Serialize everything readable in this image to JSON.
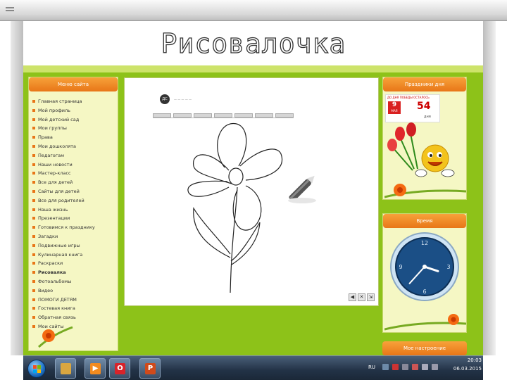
{
  "slide": {
    "title": "Рисовалочка"
  },
  "site": {
    "left_panel": {
      "title": "Меню сайта",
      "items": [
        "Главная страница",
        "Мой профиль",
        "Мой детский сад",
        "Мои группы",
        "Права",
        "Мои дошколята",
        "Педагогам",
        "Наши новости",
        "Мастер-класс",
        "Все для детей",
        "Сайты для детей",
        "Все для родителей",
        "Наша жизнь",
        "Презентации",
        "Готовимся к празднику",
        "Загадки",
        "Подвижные игры",
        "Кулинарная книга",
        "Раскраски",
        "Рисовалка",
        "Фотоальбомы",
        "Видео",
        "ПОМОГИ ДЕТЯМ",
        "Гостевая книга",
        "Обратная связь",
        "Мои сайты"
      ],
      "active_index": 19
    },
    "right_panel": {
      "title": "Праздники дня",
      "badge_top": "ДО ДНЯ ПОБЕДЫ ОСТАЛОСЬ",
      "badge_date_day": "9",
      "badge_date_month": "МАЯ",
      "badge_count": "54",
      "badge_unit": "дня"
    },
    "clock_panel": {
      "title": "Время",
      "hour": 3,
      "minute": 37,
      "numerals": [
        "12",
        "3",
        "6",
        "9"
      ]
    },
    "mood_panel": {
      "title": "Мое настроение"
    },
    "drawing_app": {
      "toolbar_tabs": [
        "",
        "",
        "",
        "",
        "",
        "",
        ""
      ],
      "controls": [
        "◀",
        "✕",
        "⇲"
      ]
    }
  },
  "taskbar": {
    "apps": [
      {
        "name": "explorer",
        "glyph": "",
        "color": "#d9a640"
      },
      {
        "name": "media",
        "glyph": "▶",
        "color": "#f28b1f"
      },
      {
        "name": "opera",
        "glyph": "O",
        "color": "#d8232a"
      },
      {
        "name": "powerpoint",
        "glyph": "P",
        "color": "#d04a1b"
      }
    ],
    "language": "RU",
    "time": "20:03",
    "date": "06.03.2015"
  },
  "colors": {
    "site_green": "#8dc219",
    "panel_header_orange": "#e87618",
    "panel_bg": "#f5f7c4",
    "clock_blue": "#1b4f86"
  }
}
